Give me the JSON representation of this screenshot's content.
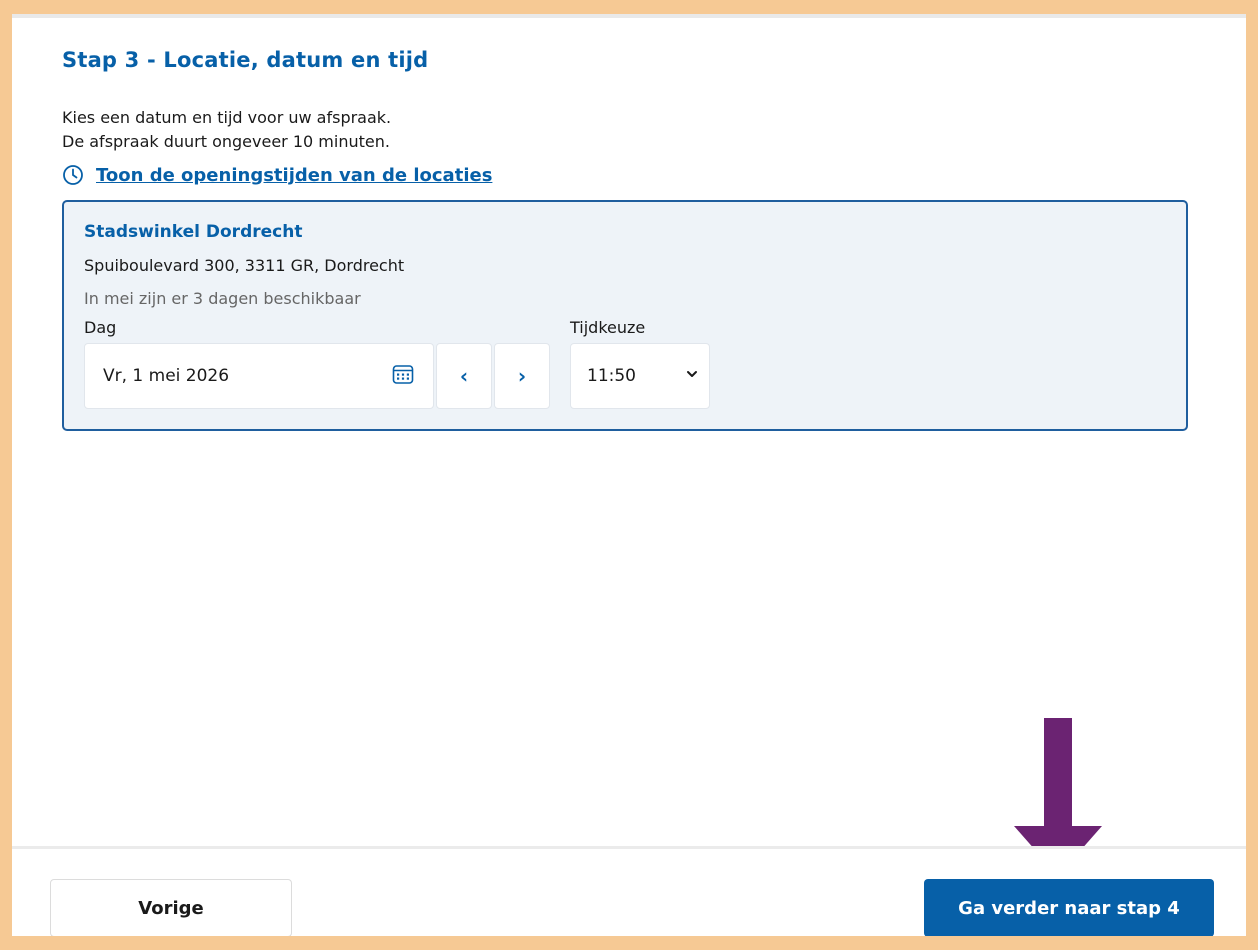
{
  "step": {
    "title": "Stap 3 - Locatie, datum en tijd",
    "intro_line1": "Kies een datum en tijd voor uw afspraak.",
    "intro_line2": "De afspraak duurt ongeveer 10 minuten.",
    "opening_hours_link": "Toon de openingstijden van de locaties"
  },
  "location": {
    "name": "Stadswinkel Dordrecht",
    "address": "Spuiboulevard 300, 3311 GR, Dordrecht",
    "availability": "In mei zijn er 3 dagen beschikbaar",
    "day_label": "Dag",
    "day_value": "Vr, 1 mei 2026",
    "prev_day": "‹",
    "next_day": "›",
    "time_label": "Tijdkeuze",
    "time_value": "11:50"
  },
  "footer": {
    "prev_label": "Vorige",
    "next_label": "Ga verder naar stap 4"
  },
  "colors": {
    "primary": "#0760a8",
    "card_bg": "#eef3f8",
    "frame_border": "#f6c994",
    "annotation_arrow": "#6b2372"
  },
  "icons": {
    "hours": "clock-icon",
    "day": "calendar-icon",
    "time": "chevron-down-icon",
    "annotation": "arrow-down-icon"
  }
}
